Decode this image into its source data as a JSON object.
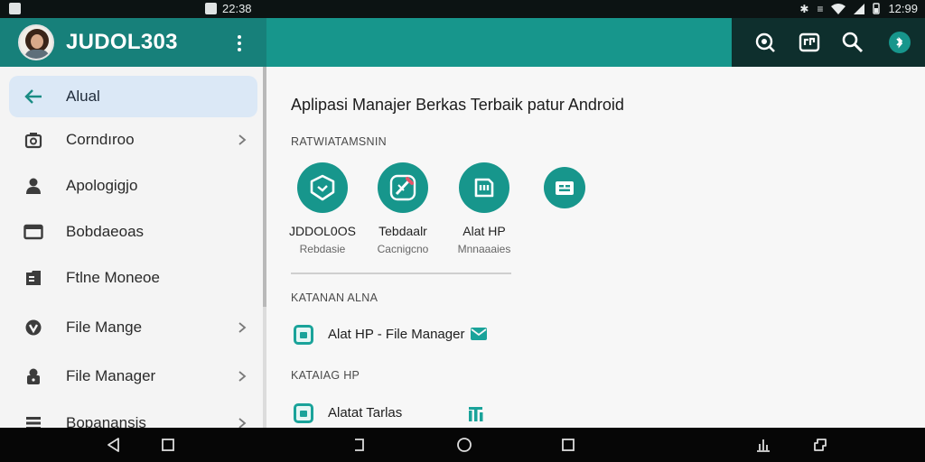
{
  "status_bar": {
    "time_left": "22:38",
    "time_right": "12:99"
  },
  "app": {
    "title": "JUDOL303"
  },
  "toolbar": {
    "icons": [
      "zoom-icon",
      "storage-icon",
      "search-icon",
      "bluetooth-icon"
    ],
    "colors": {
      "accent": "#17968c",
      "appbar_left": "#17807a",
      "appbar_right": "#0e2f2d"
    }
  },
  "sidebar": {
    "items": [
      {
        "label": "Alual",
        "icon": "back-arrow-icon",
        "active": true,
        "chevron": false
      },
      {
        "label": "Corndıroo",
        "icon": "camera-icon",
        "active": false,
        "chevron": true
      },
      {
        "label": "Apologigjo",
        "icon": "person-icon",
        "active": false,
        "chevron": false
      },
      {
        "label": "Bobdaeoas",
        "icon": "folder-icon",
        "active": false,
        "chevron": false
      },
      {
        "label": "Ftlne Moneoe",
        "icon": "files-icon",
        "active": false,
        "chevron": false
      },
      {
        "label": "File Mange",
        "icon": "shield-icon",
        "active": false,
        "chevron": true
      },
      {
        "label": "File Manager",
        "icon": "lock-icon",
        "active": false,
        "chevron": true
      },
      {
        "label": "Bopanansis",
        "icon": "list-icon",
        "active": false,
        "chevron": true
      }
    ]
  },
  "main": {
    "title": "Aplipasi Manajer Berkas Terbaik patur Android",
    "section1_label": "RATWIATAMSNIN",
    "apps": [
      {
        "name": "JDDOL0OS",
        "sub": "Rebdasie",
        "icon": "shield-check-icon"
      },
      {
        "name": "Tebdaalr",
        "sub": "Cacnigcno",
        "icon": "edit-tool-icon"
      },
      {
        "name": "Alat HP",
        "sub": "Mnnaaaies",
        "icon": "sd-card-icon"
      },
      {
        "name": "",
        "sub": "",
        "icon": "archive-icon"
      }
    ],
    "section2_label": "KATANAN ALNA",
    "file1_label": "Alat HP - File Manager",
    "section3_label": "KATAIAG HP",
    "file2_label": "Alatat Tarlas"
  }
}
